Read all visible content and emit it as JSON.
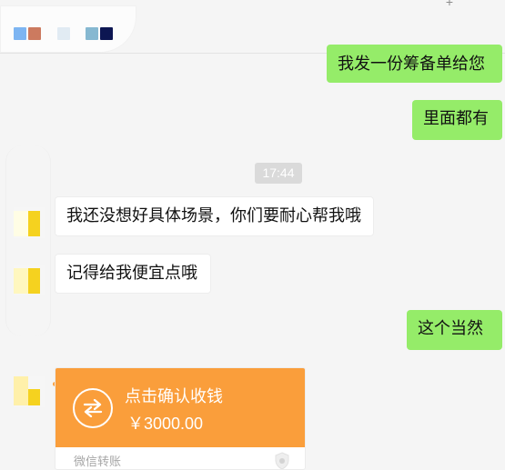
{
  "header": {
    "top_right_icon": "plus-icon",
    "pixel_avatar_colors": [
      "#7db5f2",
      "#cc7a5f",
      "#e1ebf3",
      "#86b8d1",
      "#0d1652"
    ]
  },
  "messages": [
    {
      "side": "right",
      "text": "我发一份筹备单给您"
    },
    {
      "side": "right",
      "text": "里面都有"
    },
    {
      "side": "left",
      "text": "我还没想好具体场景，你们要耐心帮我哦"
    },
    {
      "side": "left",
      "text": "记得给我便宜点哦"
    },
    {
      "side": "right",
      "text": "这个当然"
    }
  ],
  "timestamp": "17:44",
  "transfer": {
    "title": "点击确认收钱",
    "amount": "￥3000.00",
    "footer": "微信转账",
    "icon": "transfer-arrows-icon",
    "badge_icon": "shield-icon",
    "accent_color": "#fa9e3b"
  },
  "colors": {
    "background": "#f5f5f5",
    "sent_bubble": "#95ec69",
    "received_bubble": "#ffffff",
    "timestamp_bg": "#dadada"
  }
}
